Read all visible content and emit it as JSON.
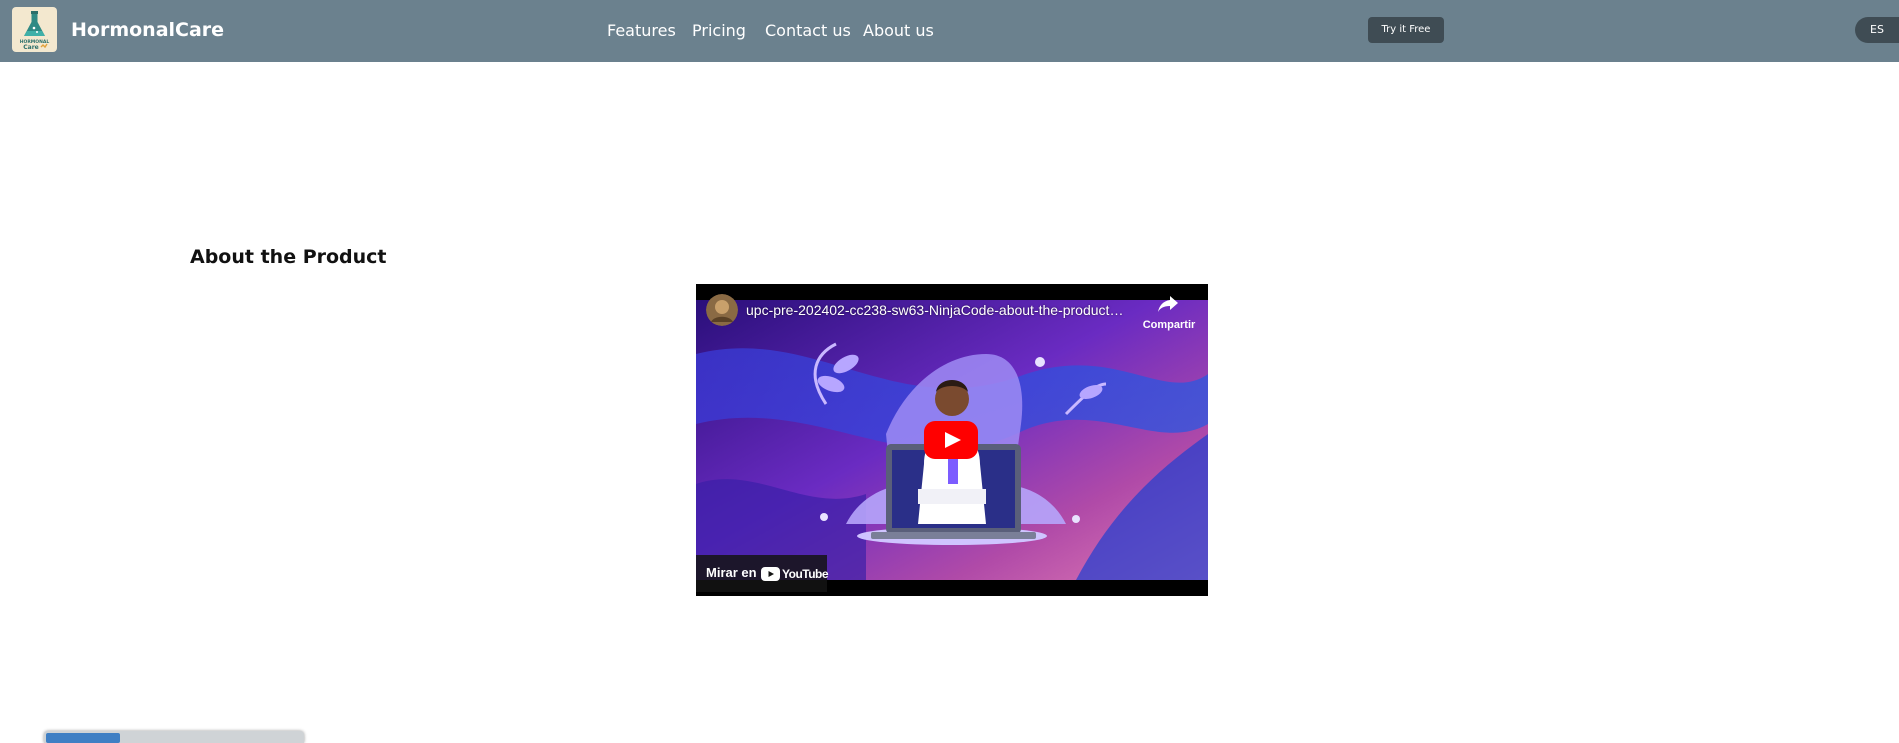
{
  "header": {
    "brand": "HormonalCare",
    "nav": [
      "Features",
      "Pricing",
      "Contact us",
      "About us"
    ],
    "cta_label": "Try it Free",
    "language": "ES"
  },
  "logo": {
    "text_top": "HORMONAL",
    "text_bottom": "Care"
  },
  "section": {
    "title": "About the Product"
  },
  "video": {
    "title": "upc-pre-202402-cc238-sw63-NinjaCode-about-the-product-video",
    "share_label": "Compartir",
    "watch_on_label": "Mirar en",
    "youtube_wordmark": "YouTube"
  },
  "colors": {
    "navbar": "#6b818e",
    "button": "#3f4c54",
    "youtube_red": "#ff0000"
  },
  "icons": [
    "flask-logo-icon",
    "share-icon",
    "play-icon",
    "youtube-logo-icon"
  ]
}
